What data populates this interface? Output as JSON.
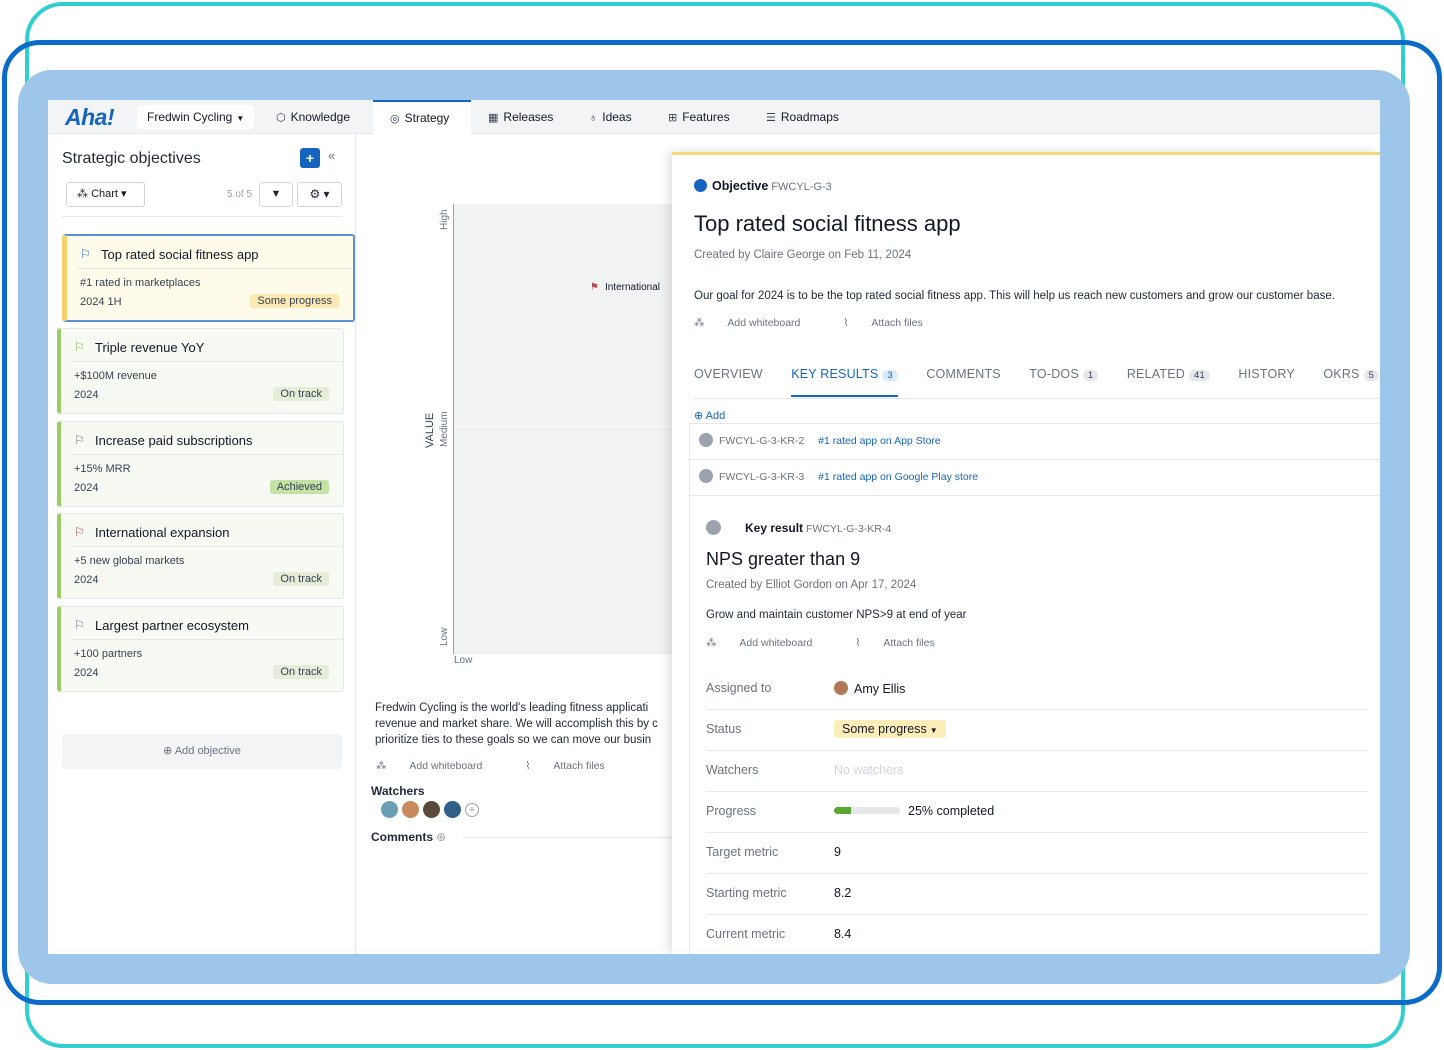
{
  "brand": {
    "logo": "Aha!",
    "accent": "#1565c0"
  },
  "nav": {
    "workspace": "Fredwin Cycling",
    "tabs": [
      {
        "label": "Knowledge",
        "icon": "cube-icon"
      },
      {
        "label": "Strategy",
        "icon": "target-icon",
        "active": true
      },
      {
        "label": "Releases",
        "icon": "calendar-icon"
      },
      {
        "label": "Ideas",
        "icon": "lightbulb-icon"
      },
      {
        "label": "Features",
        "icon": "grid-icon"
      },
      {
        "label": "Roadmaps",
        "icon": "roadmap-icon"
      }
    ]
  },
  "sidebar": {
    "title": "Strategic objectives",
    "view_button": "Chart",
    "count": "5 of 5",
    "add_objective": "Add objective",
    "objectives": [
      {
        "title": "Top rated social fitness app",
        "metric": "#1 rated in marketplaces",
        "period": "2024 1H",
        "status": "Some progress",
        "selected": true
      },
      {
        "title": "Triple revenue YoY",
        "metric": "+$100M revenue",
        "period": "2024",
        "status": "On track"
      },
      {
        "title": "Increase paid subscriptions",
        "metric": "+15% MRR",
        "period": "2024",
        "status": "Achieved"
      },
      {
        "title": "International expansion",
        "metric": "+5 new global markets",
        "period": "2024",
        "status": "On track"
      },
      {
        "title": "Largest partner ecosystem",
        "metric": "+100 partners",
        "period": "2024",
        "status": "On track"
      }
    ]
  },
  "chart": {
    "y_axis": "VALUE",
    "y_high": "High",
    "y_medium": "Medium",
    "y_low": "Low",
    "x_low": "Low",
    "point_label": "International"
  },
  "center": {
    "description_lines": [
      "Fredwin Cycling is the world's leading fitness applicati",
      "revenue and market share. We will accomplish this by c",
      "prioritize ties to these goals so we can move our busin"
    ],
    "add_whiteboard": "Add whiteboard",
    "attach_files": "Attach files",
    "watchers_heading": "Watchers",
    "comments_heading": "Comments"
  },
  "objective": {
    "type": "Objective",
    "code": "FWCYL-G-3",
    "title": "Top rated social fitness app",
    "created": "Created by Claire George on Feb 11, 2024",
    "description": "Our goal for 2024 is to be the top rated social fitness app. This will help us reach new customers and grow our customer base.",
    "add_whiteboard": "Add whiteboard",
    "attach_files": "Attach files",
    "tabs": [
      {
        "label": "OVERVIEW",
        "badge": ""
      },
      {
        "label": "KEY RESULTS",
        "badge": "3",
        "active": true
      },
      {
        "label": "COMMENTS",
        "badge": ""
      },
      {
        "label": "TO-DOS",
        "badge": "1"
      },
      {
        "label": "RELATED",
        "badge": "41"
      },
      {
        "label": "HISTORY",
        "badge": ""
      },
      {
        "label": "OKRS",
        "badge": "5"
      }
    ],
    "add_label": "Add",
    "key_results": [
      {
        "id": "FWCYL-G-3-KR-2",
        "name": "#1 rated app on App Store"
      },
      {
        "id": "FWCYL-G-3-KR-3",
        "name": "#1 rated app on Google Play store"
      }
    ]
  },
  "key_result": {
    "type": "Key result",
    "code": "FWCYL-G-3-KR-4",
    "title": "NPS greater than 9",
    "created": "Created by Elliot Gordon on Apr 17, 2024",
    "description": "Grow and maintain customer NPS>9 at end of year",
    "add_whiteboard": "Add whiteboard",
    "attach_files": "Attach files",
    "fields": {
      "assigned_label": "Assigned to",
      "assigned_value": "Amy Ellis",
      "status_label": "Status",
      "status_value": "Some progress",
      "watchers_label": "Watchers",
      "watchers_value": "No watchers",
      "progress_label": "Progress",
      "progress_value": "25% completed",
      "progress_fraction": 0.25,
      "target_label": "Target metric",
      "target_value": "9",
      "starting_label": "Starting metric",
      "starting_value": "8.2",
      "current_label": "Current metric",
      "current_value": "8.4"
    }
  }
}
